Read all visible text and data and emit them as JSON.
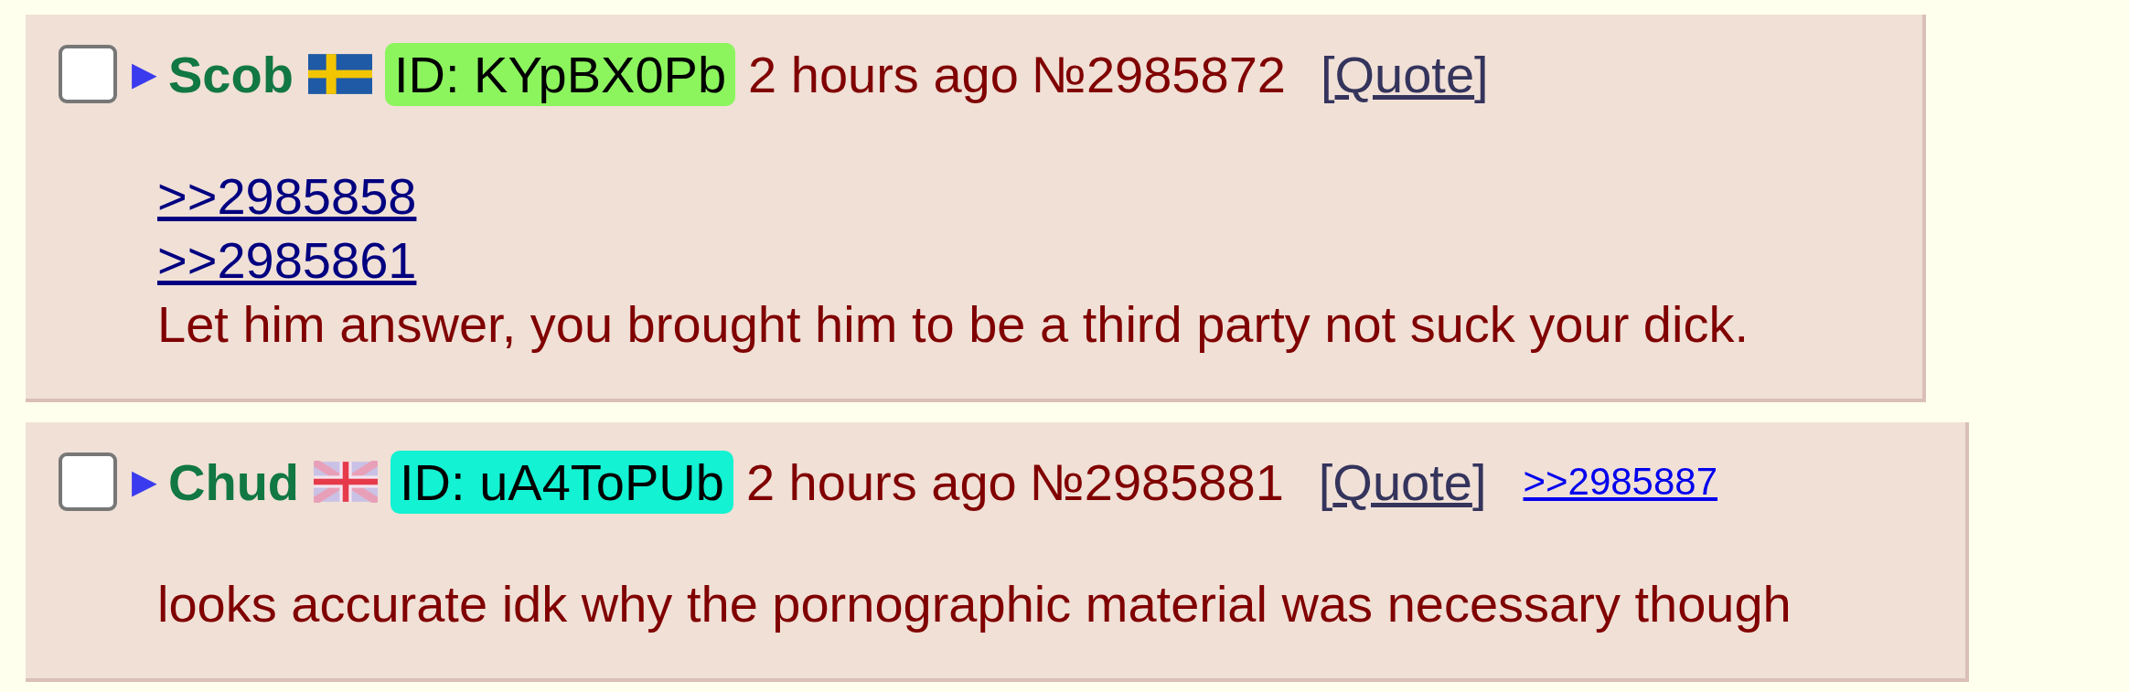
{
  "posts": [
    {
      "checked": false,
      "expander": "▶",
      "name": "Scob",
      "flag": {
        "kind": "sweden"
      },
      "id": "ID: KYpBX0Pb",
      "color": "#8cf55e",
      "time": "2 hours ago",
      "number": "№2985872",
      "quote": {
        "open": "[",
        "label": "Quote",
        "close": "]"
      },
      "body": [
        {
          "kind": "quotelink",
          "text": ">>2985858"
        },
        {
          "kind": "quotelink",
          "text": ">>2985861"
        },
        {
          "kind": "text",
          "text": "Let him answer, you brought him to be a third party not suck your dick."
        }
      ]
    },
    {
      "checked": false,
      "expander": "▶",
      "name": "Chud",
      "flag": {
        "kind": "union"
      },
      "id": "ID: uA4ToPUb",
      "color": "#13f2d2",
      "time": "2 hours ago",
      "number": "№2985881",
      "quote": {
        "open": "[",
        "label": "Quote",
        "close": "]"
      },
      "replies": [
        ">>2985887"
      ],
      "body": [
        {
          "kind": "text",
          "text": "looks accurate idk why the pornographic material was necessary though"
        }
      ]
    }
  ]
}
